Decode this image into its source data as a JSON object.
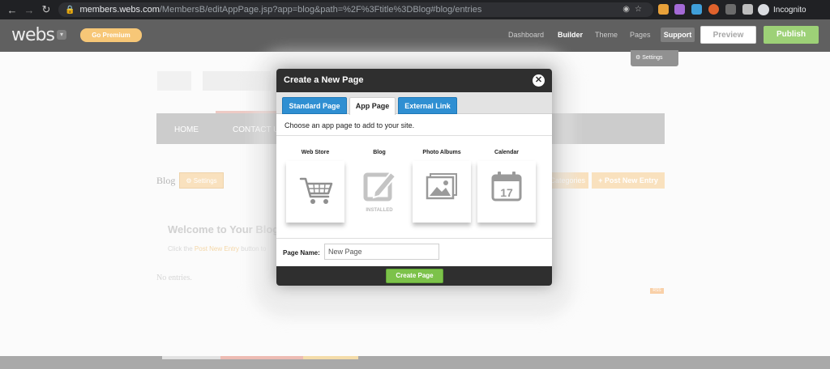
{
  "browser": {
    "url_host": "members.webs.com",
    "url_path": "/MembersB/editAppPage.jsp?app=blog&path=%2F%3Ftitle%3DBlog#blog/entries",
    "profile_label": "Incognito"
  },
  "app_bar": {
    "logo": "webs",
    "premium_label": "Go Premium",
    "nav": [
      "Dashboard",
      "Builder",
      "Theme",
      "Pages"
    ],
    "support_label": "Support",
    "preview_label": "Preview",
    "publish_label": "Publish",
    "settings_label": "Settings"
  },
  "page": {
    "menu_items": [
      "HOME",
      "CONTACT US"
    ],
    "blog_heading": "Blog",
    "blog_settings_label": "Settings",
    "categories_label": "Categories",
    "post_label": "+ Post New Entry",
    "welcome": "Welcome to Your Blog",
    "click_prefix": "Click the",
    "click_link": "Post New Entry",
    "click_suffix": "button to",
    "no_entries": "No entries.",
    "rss": "RSS"
  },
  "modal": {
    "title": "Create a New Page",
    "tabs": [
      "Standard Page",
      "App Page",
      "External Link"
    ],
    "prompt": "Choose an app page to add to your site.",
    "apps": [
      {
        "label": "Web Store",
        "icon": "cart-icon"
      },
      {
        "label": "Blog",
        "icon": "blog-edit-icon",
        "status": "INSTALLED"
      },
      {
        "label": "Photo Albums",
        "icon": "photo-icon"
      },
      {
        "label": "Calendar",
        "icon": "calendar-icon",
        "day": "17"
      }
    ],
    "page_name_label": "Page Name:",
    "page_name_value": "New Page",
    "create_label": "Create Page"
  }
}
